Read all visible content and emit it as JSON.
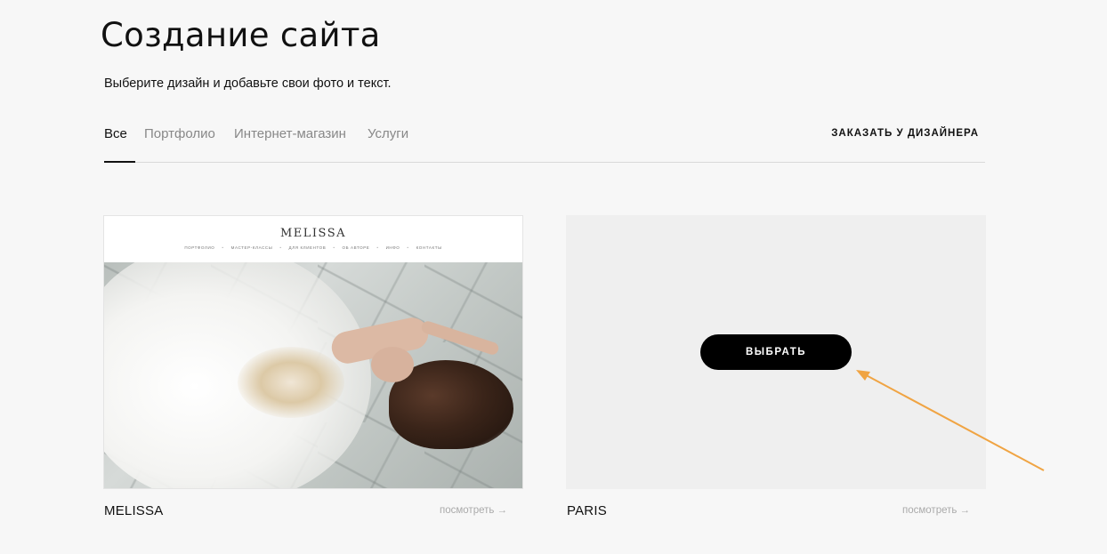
{
  "header": {
    "title": "Создание сайта",
    "subtitle": "Выберите дизайн и добавьте свои фото и текст."
  },
  "tabs": [
    {
      "label": "Все",
      "active": true
    },
    {
      "label": "Портфолио",
      "active": false
    },
    {
      "label": "Интернет-магазин",
      "active": false
    },
    {
      "label": "Услуги",
      "active": false
    }
  ],
  "designer_link": "ЗАКАЗАТЬ У ДИЗАЙНЕРА",
  "templates": [
    {
      "name": "MELISSA",
      "view_label": "посмотреть →",
      "preview": {
        "logo": "MELISSA",
        "nav": [
          "ПОРТФОЛИО",
          "МАСТЕР-КЛАССЫ",
          "ДЛЯ КЛИЕНТОВ",
          "ОБ АВТОРЕ",
          "ИНФО",
          "КОНТАКТЫ"
        ]
      }
    },
    {
      "name": "PARIS",
      "view_label": "посмотреть →",
      "choose_label": "ВЫБРАТЬ"
    }
  ],
  "annotation": {
    "arrow_color": "#f0a443"
  },
  "colors": {
    "accent": "#000000",
    "background": "#f7f7f7",
    "muted": "#888888"
  }
}
